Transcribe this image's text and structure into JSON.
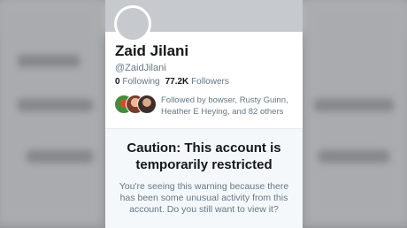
{
  "profile": {
    "name": "Zaid Jilani",
    "handle": "@ZaidJilani",
    "following_count": "0",
    "following_label": "Following",
    "followers_count": "77.2K",
    "followers_label": "Followers",
    "followed_by_text": "Followed by bowser, Rusty Guinn, Heather E Heying, and 82 others"
  },
  "warning": {
    "title": "Caution: This account is temporarily restricted",
    "body": "You're seeing this warning because there has been some unusual activity from this account. Do you still want to view it?"
  },
  "colors": {
    "text_primary": "#14171a",
    "text_secondary": "#657786",
    "banner": "#c6cacf",
    "warning_bg": "#f5f8fa"
  }
}
